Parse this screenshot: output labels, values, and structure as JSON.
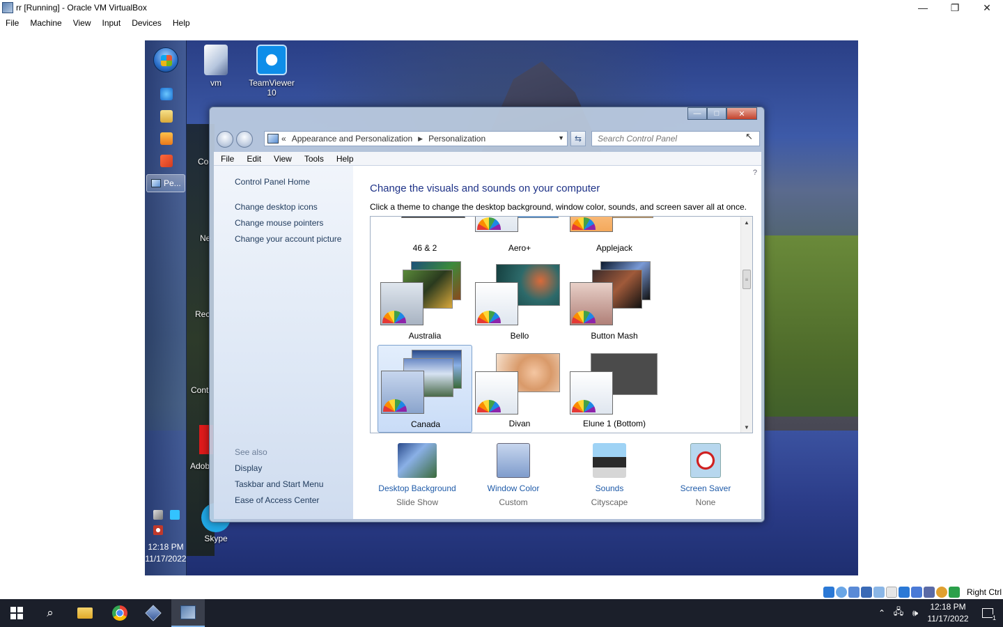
{
  "host": {
    "title": "rr [Running] - Oracle VM VirtualBox",
    "controls": {
      "minimize": "—",
      "restore": "❐",
      "close": "✕"
    },
    "menu": [
      "File",
      "Machine",
      "View",
      "Input",
      "Devices",
      "Help"
    ],
    "status_hostkey": "Right Ctrl",
    "taskbar": {
      "time": "12:18 PM",
      "date": "11/17/2022",
      "notification_count": "1"
    }
  },
  "guest": {
    "taskbar": {
      "active_button": "Pe...",
      "time": "12:18 PM",
      "date": "11/17/2022"
    },
    "desktop_icons": [
      {
        "label": "vm"
      },
      {
        "label": "TeamViewer 10"
      },
      {
        "label": "Skype"
      }
    ],
    "partial_labels": [
      "Co",
      "Ne",
      "Rec",
      "Cont",
      "Adob"
    ]
  },
  "window": {
    "caption": {
      "minimize": "—",
      "maximize": "□",
      "close": "✕"
    },
    "address": {
      "prefix": "«",
      "crumb1": "Appearance and Personalization",
      "crumb2": "Personalization"
    },
    "search_placeholder": "Search Control Panel",
    "menu": [
      "File",
      "Edit",
      "View",
      "Tools",
      "Help"
    ],
    "left_pane": {
      "home": "Control Panel Home",
      "links": [
        "Change desktop icons",
        "Change mouse pointers",
        "Change your account picture"
      ],
      "see_also_title": "See also",
      "see_also": [
        "Display",
        "Taskbar and Start Menu",
        "Ease of Access Center"
      ]
    },
    "main": {
      "title": "Change the visuals and sounds on your computer",
      "description": "Click a theme to change the desktop background, window color, sounds, and screen saver all at once.",
      "themes": [
        {
          "name": "46 & 2"
        },
        {
          "name": "Aero+"
        },
        {
          "name": "Applejack"
        },
        {
          "name": "Australia"
        },
        {
          "name": "Bello"
        },
        {
          "name": "Button Mash"
        },
        {
          "name": "Canada",
          "selected": true
        },
        {
          "name": "Divan"
        },
        {
          "name": "Elune 1 (Bottom)"
        }
      ],
      "bottom": [
        {
          "label": "Desktop Background",
          "sub": "Slide Show"
        },
        {
          "label": "Window Color",
          "sub": "Custom"
        },
        {
          "label": "Sounds",
          "sub": "Cityscape"
        },
        {
          "label": "Screen Saver",
          "sub": "None"
        }
      ]
    }
  }
}
